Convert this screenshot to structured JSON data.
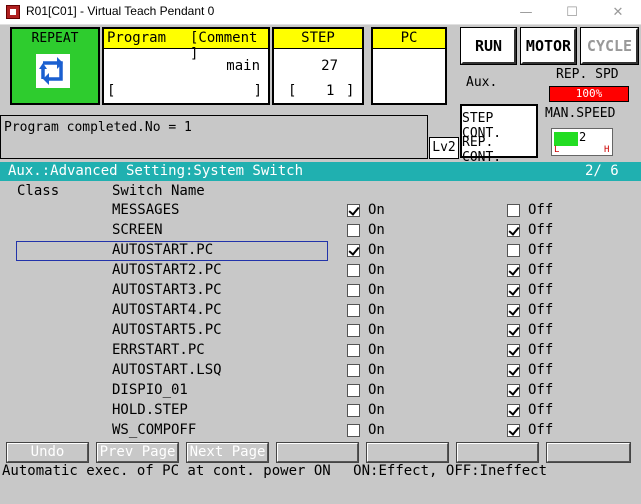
{
  "window": {
    "title": "R01[C01] - Virtual Teach Pendant 0"
  },
  "top": {
    "repeat_label": "REPEAT",
    "program": {
      "head_left": "Program",
      "head_right": "[Comment ]",
      "name": "main",
      "comment_open": "[",
      "comment_close": "]"
    },
    "step": {
      "head": "STEP",
      "value": "27",
      "sub_open": "[",
      "sub_value": "1",
      "sub_close": "]"
    },
    "pc": {
      "head": "PC"
    },
    "run_label": "RUN",
    "motor_label": "MOTOR",
    "cycle_label": "CYCLE",
    "aux_label": "Aux.",
    "rep_spd_label": "REP. SPD",
    "rep_spd_value": "100%",
    "step_cont_label": "STEP CONT.",
    "rep_cont_label": "REP. CONT.",
    "man_speed_label": "MAN.SPEED",
    "man_speed_value": "2",
    "man_speed_low": "L",
    "man_speed_high": "H",
    "lv_label": "Lv2",
    "message": "Program completed.No = 1"
  },
  "section": {
    "title": "Aux.:Advanced Setting:System Switch",
    "page": "2/  6"
  },
  "columns": {
    "class": "Class",
    "switch_name": "Switch Name"
  },
  "on_label": "On",
  "off_label": "Off",
  "switches": [
    {
      "name": "MESSAGES",
      "on": true
    },
    {
      "name": "SCREEN",
      "on": false
    },
    {
      "name": "AUTOSTART.PC",
      "on": true
    },
    {
      "name": "AUTOSTART2.PC",
      "on": false
    },
    {
      "name": "AUTOSTART3.PC",
      "on": false
    },
    {
      "name": "AUTOSTART4.PC",
      "on": false
    },
    {
      "name": "AUTOSTART5.PC",
      "on": false
    },
    {
      "name": "ERRSTART.PC",
      "on": false
    },
    {
      "name": "AUTOSTART.LSQ",
      "on": false
    },
    {
      "name": "DISPIO_01",
      "on": false
    },
    {
      "name": "HOLD.STEP",
      "on": false
    },
    {
      "name": "WS_COMPOFF",
      "on": false
    }
  ],
  "selected_index": 2,
  "buttons": {
    "undo": "Undo",
    "prev_page": "Prev Page",
    "next_page": "Next Page"
  },
  "help": {
    "text": "Automatic exec. of PC at cont. power ON",
    "legend": "ON:Effect, OFF:Ineffect"
  }
}
